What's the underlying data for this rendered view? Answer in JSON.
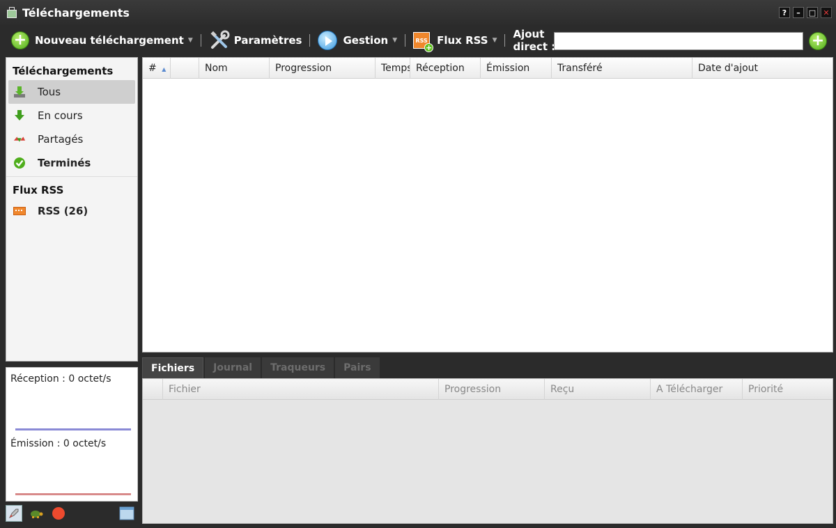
{
  "window": {
    "title": "Téléchargements",
    "controls": [
      "?",
      "–",
      "□",
      "✕"
    ]
  },
  "toolbar": {
    "new_download": "Nouveau téléchargement",
    "settings": "Paramètres",
    "management": "Gestion",
    "rss": "Flux RSS",
    "rss_icon_text": "RSS",
    "direct_add_line1": "Ajout",
    "direct_add_line2": "direct :",
    "direct_add_value": ""
  },
  "sidebar": {
    "downloads_header": "Téléchargements",
    "items": [
      {
        "label": "Tous",
        "icon": "download-tray-icon",
        "active": true
      },
      {
        "label": "En cours",
        "icon": "arrow-down-icon"
      },
      {
        "label": "Partagés",
        "icon": "share-arrows-icon"
      },
      {
        "label": "Terminés",
        "icon": "check-icon"
      }
    ],
    "rss_header": "Flux RSS",
    "rss_item": {
      "label": "RSS (26)",
      "icon": "rss-feed-icon"
    }
  },
  "stats": {
    "reception": "Réception : 0 octet/s",
    "emission": "Émission : 0 octet/s",
    "reception_color": "#8a8ad6",
    "emission_color": "#d88a8a"
  },
  "table": {
    "columns": [
      "#",
      "",
      "Nom",
      "Progression",
      "Temps",
      "Réception",
      "Émission",
      "Transféré",
      "Date d'ajout"
    ],
    "rows": []
  },
  "details": {
    "tabs": [
      "Fichiers",
      "Journal",
      "Traqueurs",
      "Pairs"
    ],
    "columns": [
      "",
      "Fichier",
      "Progression",
      "Reçu",
      "A Télécharger",
      "Priorité"
    ]
  },
  "colors": {
    "accent_green": "#4fae1c",
    "rss_orange": "#f0872c",
    "dark_bg": "#2b2b2b"
  }
}
